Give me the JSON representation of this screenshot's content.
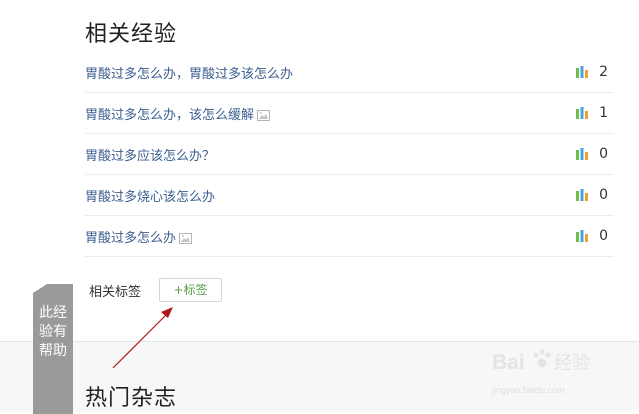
{
  "related": {
    "title": "相关经验",
    "items": [
      {
        "title": "胃酸过多怎么办，胃酸过多该怎么办",
        "has_image": false,
        "count": "2"
      },
      {
        "title": "胃酸过多怎么办，该怎么缓解",
        "has_image": true,
        "count": "1"
      },
      {
        "title": "胃酸过多应该怎么办？",
        "has_image": false,
        "count": "0"
      },
      {
        "title": "胃酸过多烧心该怎么办",
        "has_image": false,
        "count": "0"
      },
      {
        "title": "胃酸过多怎么办",
        "has_image": true,
        "count": "0"
      }
    ]
  },
  "tags": {
    "label": "相关标签",
    "add_label": "+标签"
  },
  "magazine": {
    "title": "热门杂志"
  },
  "helpful_tab": {
    "text": "此经验有帮助"
  },
  "watermark": {
    "brand": "Baidu经验",
    "url": "jingyan.baidu.com"
  },
  "colors": {
    "link": "#3b5f8f",
    "tag_green": "#5aa04b",
    "bar_green": "#6cbf4f",
    "bar_blue": "#4aa3df",
    "bar_orange": "#f0a030",
    "arrow_red": "#b01818"
  },
  "icons": {
    "stats": "bar-chart-icon",
    "image": "image-icon",
    "helpful": "helpful-tab"
  }
}
